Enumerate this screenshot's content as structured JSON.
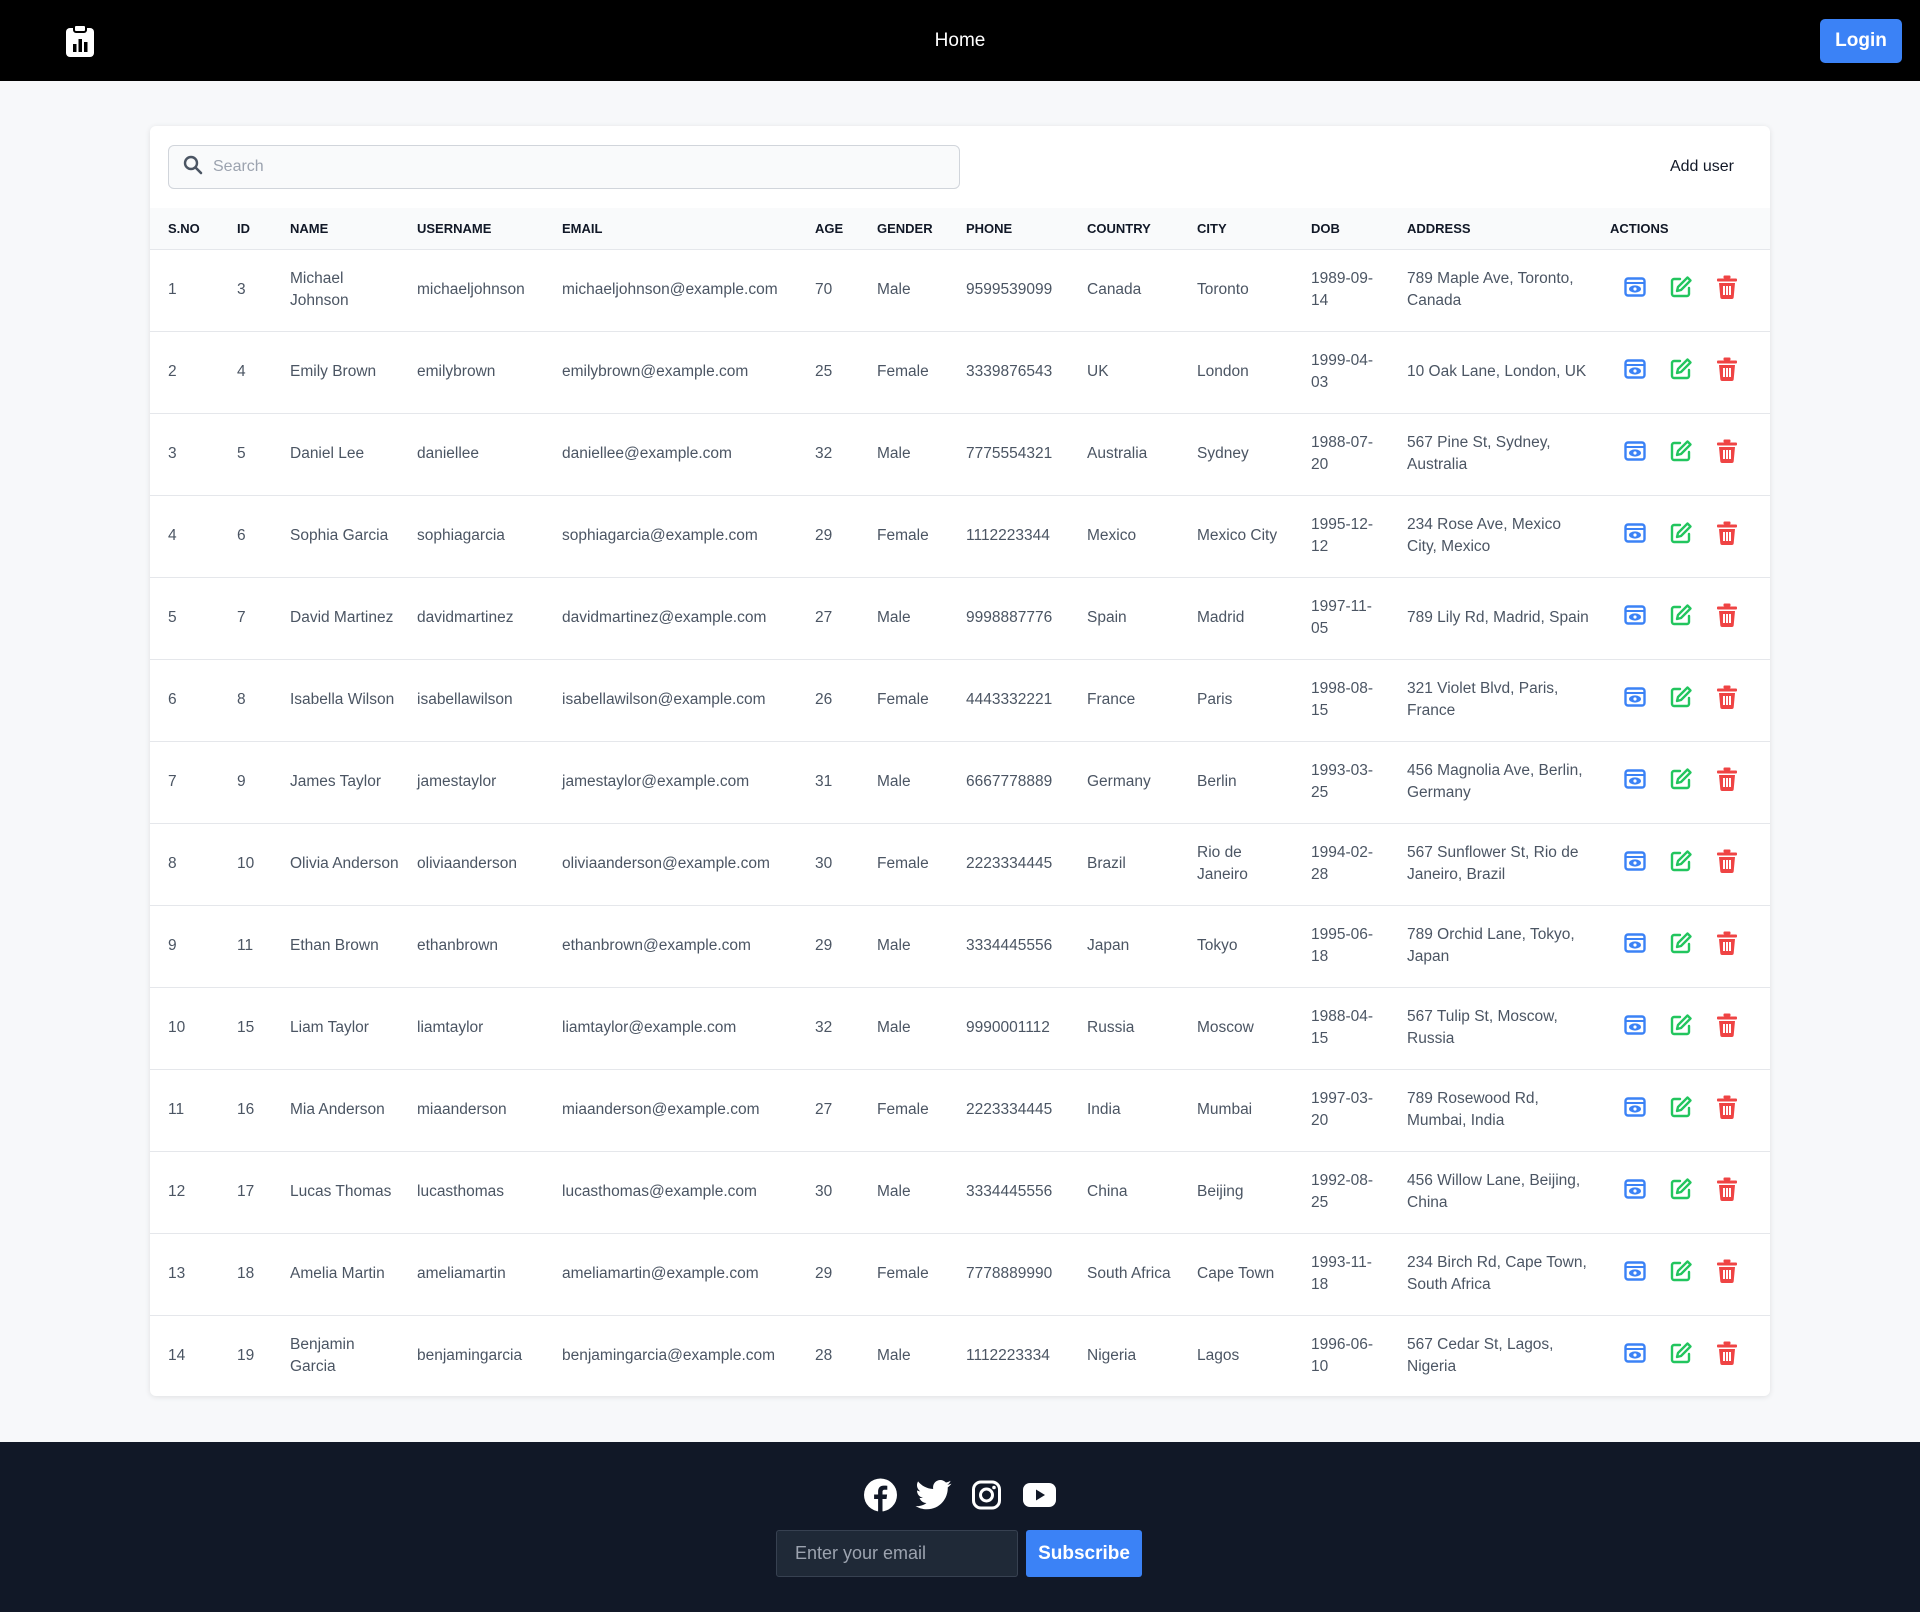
{
  "header": {
    "nav_home": "Home",
    "login_label": "Login",
    "logo_icon": "clipboard-chart-icon"
  },
  "toolbar": {
    "search_placeholder": "Search",
    "search_value": "",
    "add_user_label": "Add user"
  },
  "table": {
    "columns": [
      "S.NO",
      "ID",
      "NAME",
      "USERNAME",
      "EMAIL",
      "AGE",
      "GENDER",
      "PHONE",
      "COUNTRY",
      "CITY",
      "DOB",
      "ADDRESS",
      "ACTIONS"
    ],
    "rows": [
      {
        "sno": "1",
        "id": "3",
        "name": "Michael Johnson",
        "username": "michaeljohnson",
        "email": "michaeljohnson@example.com",
        "age": "70",
        "gender": "Male",
        "phone": "9599539099",
        "country": "Canada",
        "city": "Toronto",
        "dob": "1989-09-14",
        "address": "789 Maple Ave, Toronto, Canada"
      },
      {
        "sno": "2",
        "id": "4",
        "name": "Emily Brown",
        "username": "emilybrown",
        "email": "emilybrown@example.com",
        "age": "25",
        "gender": "Female",
        "phone": "3339876543",
        "country": "UK",
        "city": "London",
        "dob": "1999-04-03",
        "address": "10 Oak Lane, London, UK"
      },
      {
        "sno": "3",
        "id": "5",
        "name": "Daniel Lee",
        "username": "daniellee",
        "email": "daniellee@example.com",
        "age": "32",
        "gender": "Male",
        "phone": "7775554321",
        "country": "Australia",
        "city": "Sydney",
        "dob": "1988-07-20",
        "address": "567 Pine St, Sydney, Australia"
      },
      {
        "sno": "4",
        "id": "6",
        "name": "Sophia Garcia",
        "username": "sophiagarcia",
        "email": "sophiagarcia@example.com",
        "age": "29",
        "gender": "Female",
        "phone": "1112223344",
        "country": "Mexico",
        "city": "Mexico City",
        "dob": "1995-12-12",
        "address": "234 Rose Ave, Mexico City, Mexico"
      },
      {
        "sno": "5",
        "id": "7",
        "name": "David Martinez",
        "username": "davidmartinez",
        "email": "davidmartinez@example.com",
        "age": "27",
        "gender": "Male",
        "phone": "9998887776",
        "country": "Spain",
        "city": "Madrid",
        "dob": "1997-11-05",
        "address": "789 Lily Rd, Madrid, Spain"
      },
      {
        "sno": "6",
        "id": "8",
        "name": "Isabella Wilson",
        "username": "isabellawilson",
        "email": "isabellawilson@example.com",
        "age": "26",
        "gender": "Female",
        "phone": "4443332221",
        "country": "France",
        "city": "Paris",
        "dob": "1998-08-15",
        "address": "321 Violet Blvd, Paris, France"
      },
      {
        "sno": "7",
        "id": "9",
        "name": "James Taylor",
        "username": "jamestaylor",
        "email": "jamestaylor@example.com",
        "age": "31",
        "gender": "Male",
        "phone": "6667778889",
        "country": "Germany",
        "city": "Berlin",
        "dob": "1993-03-25",
        "address": "456 Magnolia Ave, Berlin, Germany"
      },
      {
        "sno": "8",
        "id": "10",
        "name": "Olivia Anderson",
        "username": "oliviaanderson",
        "email": "oliviaanderson@example.com",
        "age": "30",
        "gender": "Female",
        "phone": "2223334445",
        "country": "Brazil",
        "city": "Rio de Janeiro",
        "dob": "1994-02-28",
        "address": "567 Sunflower St, Rio de Janeiro, Brazil"
      },
      {
        "sno": "9",
        "id": "11",
        "name": "Ethan Brown",
        "username": "ethanbrown",
        "email": "ethanbrown@example.com",
        "age": "29",
        "gender": "Male",
        "phone": "3334445556",
        "country": "Japan",
        "city": "Tokyo",
        "dob": "1995-06-18",
        "address": "789 Orchid Lane, Tokyo, Japan"
      },
      {
        "sno": "10",
        "id": "15",
        "name": "Liam Taylor",
        "username": "liamtaylor",
        "email": "liamtaylor@example.com",
        "age": "32",
        "gender": "Male",
        "phone": "9990001112",
        "country": "Russia",
        "city": "Moscow",
        "dob": "1988-04-15",
        "address": "567 Tulip St, Moscow, Russia"
      },
      {
        "sno": "11",
        "id": "16",
        "name": "Mia Anderson",
        "username": "miaanderson",
        "email": "miaanderson@example.com",
        "age": "27",
        "gender": "Female",
        "phone": "2223334445",
        "country": "India",
        "city": "Mumbai",
        "dob": "1997-03-20",
        "address": "789 Rosewood Rd, Mumbai, India"
      },
      {
        "sno": "12",
        "id": "17",
        "name": "Lucas Thomas",
        "username": "lucasthomas",
        "email": "lucasthomas@example.com",
        "age": "30",
        "gender": "Male",
        "phone": "3334445556",
        "country": "China",
        "city": "Beijing",
        "dob": "1992-08-25",
        "address": "456 Willow Lane, Beijing, China"
      },
      {
        "sno": "13",
        "id": "18",
        "name": "Amelia Martin",
        "username": "ameliamartin",
        "email": "ameliamartin@example.com",
        "age": "29",
        "gender": "Female",
        "phone": "7778889990",
        "country": "South Africa",
        "city": "Cape Town",
        "dob": "1993-11-18",
        "address": "234 Birch Rd, Cape Town, South Africa"
      },
      {
        "sno": "14",
        "id": "19",
        "name": "Benjamin Garcia",
        "username": "benjamingarcia",
        "email": "benjamingarcia@example.com",
        "age": "28",
        "gender": "Male",
        "phone": "1112223334",
        "country": "Nigeria",
        "city": "Lagos",
        "dob": "1996-06-10",
        "address": "567 Cedar St, Lagos, Nigeria"
      }
    ],
    "action_icons": [
      "view-icon",
      "edit-icon",
      "delete-icon"
    ],
    "action_colors": {
      "view": "#3b82f6",
      "edit": "#22c55e",
      "delete": "#ef4444"
    }
  },
  "footer": {
    "social_icons": [
      "facebook-icon",
      "twitter-icon",
      "instagram-icon",
      "youtube-icon"
    ],
    "email_placeholder": "Enter your email",
    "subscribe_label": "Subscribe"
  },
  "colors": {
    "accent": "#3b82f6",
    "header_bg": "#000000",
    "footer_bg": "#111827"
  }
}
